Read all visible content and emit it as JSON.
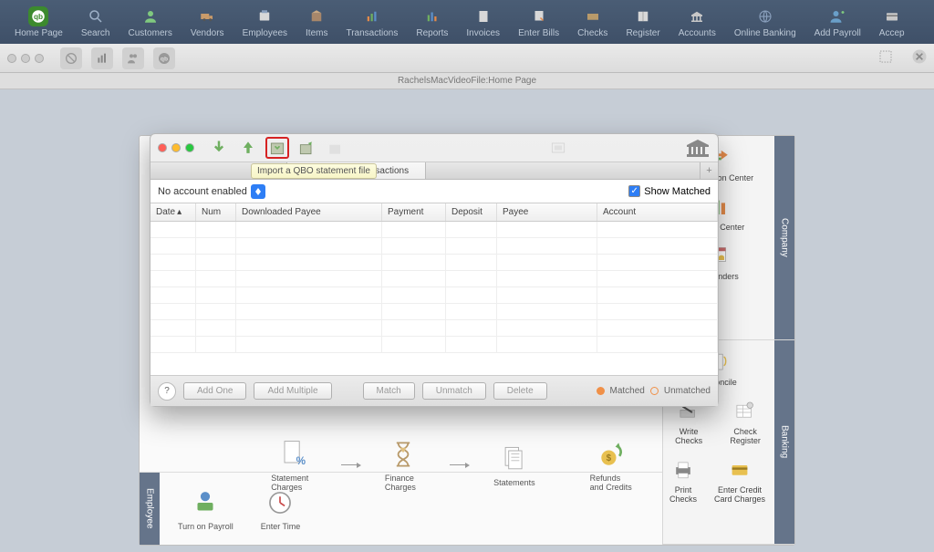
{
  "topbar": {
    "items": [
      {
        "label": "Home Page",
        "icon": "qb"
      },
      {
        "label": "Search",
        "icon": "search"
      },
      {
        "label": "Customers",
        "icon": "person"
      },
      {
        "label": "Vendors",
        "icon": "truck"
      },
      {
        "label": "Employees",
        "icon": "badge"
      },
      {
        "label": "Items",
        "icon": "box"
      },
      {
        "label": "Transactions",
        "icon": "bars"
      },
      {
        "label": "Reports",
        "icon": "bars"
      },
      {
        "label": "Invoices",
        "icon": "doc"
      },
      {
        "label": "Enter Bills",
        "icon": "pencil"
      },
      {
        "label": "Checks",
        "icon": "check"
      },
      {
        "label": "Register",
        "icon": "book"
      },
      {
        "label": "Accounts",
        "icon": "bank"
      },
      {
        "label": "Online Banking",
        "icon": "globe"
      },
      {
        "label": "Add Payroll",
        "icon": "person"
      },
      {
        "label": "Accep",
        "icon": "card"
      }
    ]
  },
  "page_title": "RachelsMacVideoFile:Home Page",
  "dlwin": {
    "tooltip": "Import a QBO statement file",
    "tabs": {
      "t1": "",
      "t2": "Downloaded Transactions"
    },
    "account_select": "No account enabled",
    "show_matched": "Show Matched",
    "cols": {
      "date": "Date",
      "num": "Num",
      "dpayee": "Downloaded Payee",
      "payment": "Payment",
      "deposit": "Deposit",
      "payee": "Payee",
      "account": "Account"
    },
    "footer": {
      "add_one": "Add One",
      "add_multiple": "Add Multiple",
      "match": "Match",
      "unmatch": "Unmatch",
      "delete": "Delete",
      "matched": "Matched",
      "unmatched": "Unmatched"
    }
  },
  "right": {
    "company": "Company",
    "banking": "Banking",
    "trans_center": "Transaction Center",
    "report_center": "Report Center",
    "reminders": "Reminders",
    "reconcile": "Reconcile",
    "write_checks": "Write Checks",
    "check_register": "Check Register",
    "print_checks": "Print Checks",
    "enter_cc": "Enter Credit Card Charges"
  },
  "flow": {
    "statement_charges": "Statement Charges",
    "finance_charges": "Finance Charges",
    "statements": "Statements",
    "refunds_credits": "Refunds and Credits"
  },
  "emp": {
    "tab": "Employee",
    "turn_on_payroll": "Turn on Payroll",
    "enter_time": "Enter Time"
  }
}
